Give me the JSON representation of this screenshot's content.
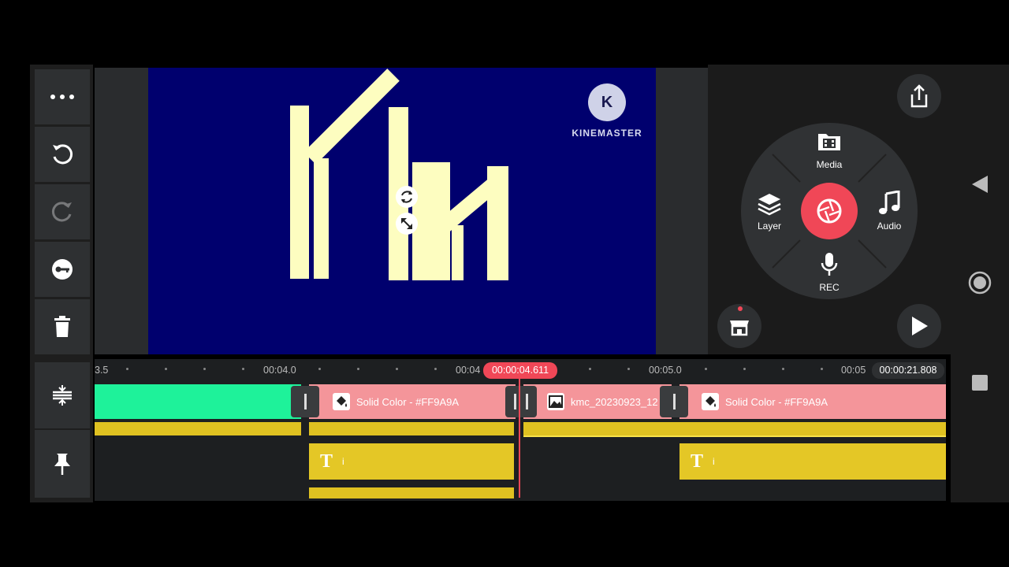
{
  "watermark": {
    "logo_letter": "K",
    "brand": "KINEMASTER"
  },
  "wheel": {
    "media_label": "Media",
    "layer_label": "Layer",
    "audio_label": "Audio",
    "rec_label": "REC"
  },
  "timeline": {
    "time_marks": [
      "3.5",
      "00:04.0",
      "00:04",
      "00:05.0",
      "00:05"
    ],
    "playhead_time": "00:00:04.611",
    "total_time": "00:00:21.808",
    "clips": [
      {
        "label": "Solid Color - #FF9A9A"
      },
      {
        "label": "kmc_20230923_12"
      },
      {
        "label": "Solid Color - #FF9A9A"
      }
    ],
    "text_layers": [
      {
        "icon_text": "T",
        "content": "i"
      },
      {
        "icon_text": "T",
        "content": "i"
      }
    ]
  },
  "colors": {
    "accent_red": "#f04757",
    "clip_pink": "#f4959a",
    "clip_green": "#1ef29a",
    "layer_yellow": "#e4c726",
    "preview_bg": "#00006e"
  }
}
